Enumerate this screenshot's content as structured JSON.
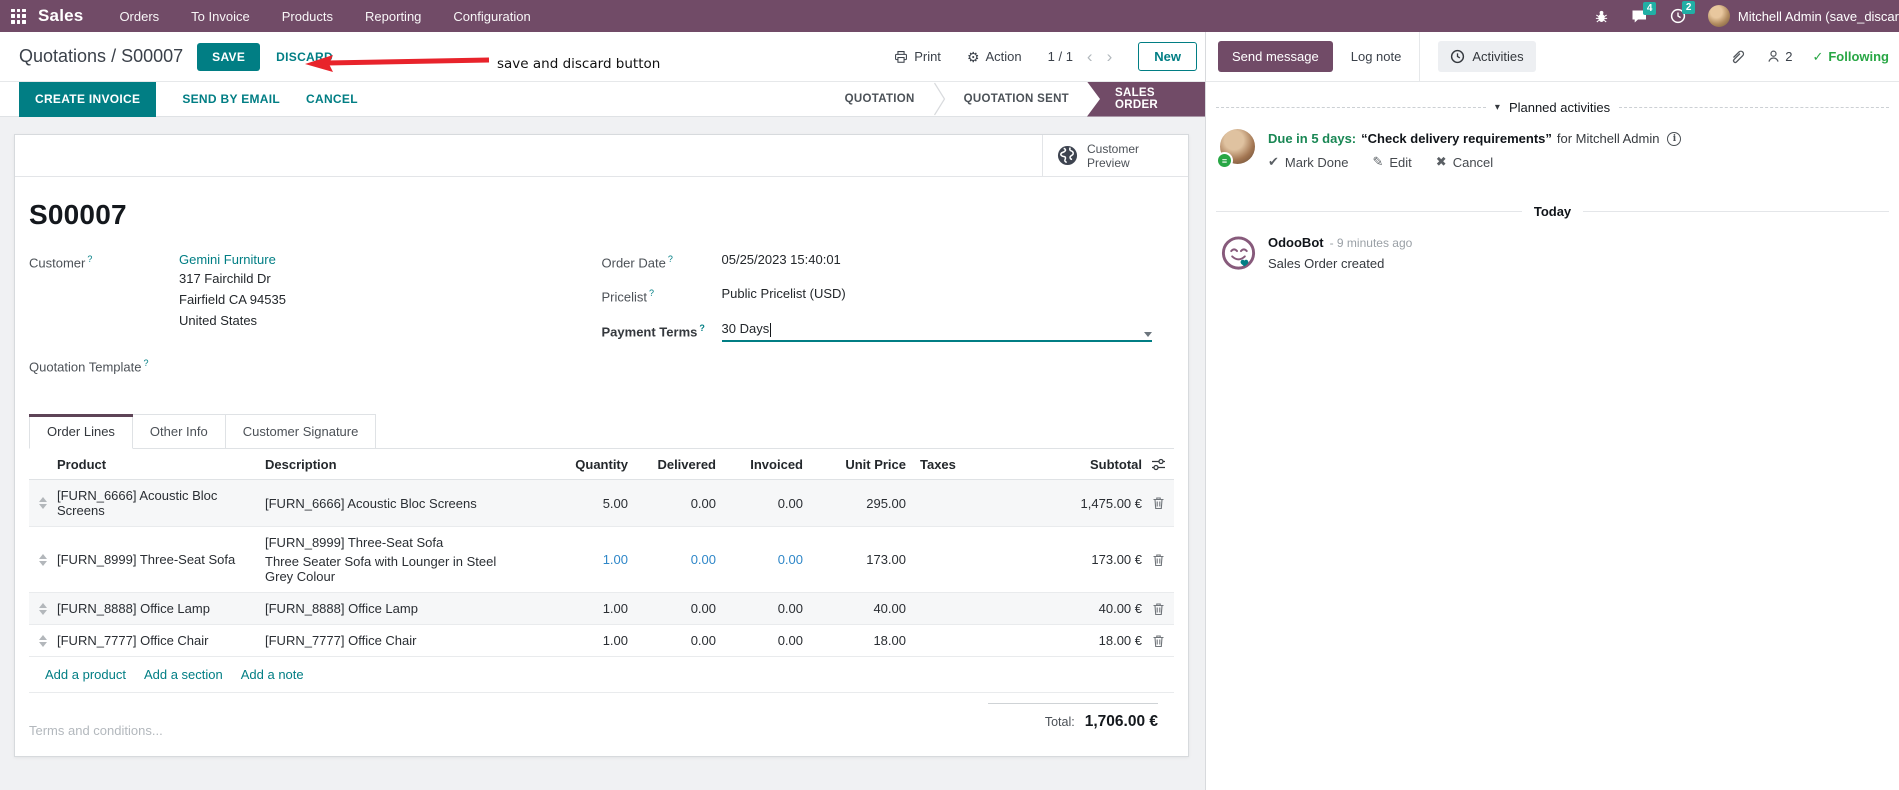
{
  "colors": {
    "brand": "#714B67",
    "primary": "#017E84",
    "success": "#28a745",
    "modified_cell": "#2f87c8",
    "annotation_red": "#e8232b",
    "badge": "#21AFA5"
  },
  "icons": {
    "gear": "⚙",
    "chevron_left": "‹",
    "chevron_right": "›",
    "caret_down": "▾",
    "check": "✔",
    "pencil": "✎",
    "cross": "✖",
    "info": "i",
    "following_check": "✓",
    "list_badge": "≡",
    "breadcrumb_sep": "/"
  },
  "topbar": {
    "app_name": "Sales",
    "menus": [
      {
        "label": "Orders"
      },
      {
        "label": "To Invoice"
      },
      {
        "label": "Products"
      },
      {
        "label": "Reporting"
      },
      {
        "label": "Configuration"
      }
    ],
    "message_count": "4",
    "activity_count": "2",
    "user_name": "Mitchell Admin (save_discar"
  },
  "control": {
    "breadcrumb": "Quotations",
    "record": "S00007",
    "save": "SAVE",
    "discard": "DISCARD",
    "print": "Print",
    "action": "Action",
    "pager": "1 / 1",
    "new": "New"
  },
  "annotation": {
    "label": "save and discard button"
  },
  "statusbar": {
    "create_invoice": "CREATE INVOICE",
    "send_by_email": "SEND BY EMAIL",
    "cancel": "CANCEL",
    "states": [
      {
        "label": "QUOTATION"
      },
      {
        "label": "QUOTATION SENT"
      },
      {
        "label": "SALES ORDER"
      }
    ],
    "active_state": "SALES ORDER"
  },
  "sheet": {
    "preview_line1": "Customer",
    "preview_line2": "Preview",
    "record_name": "S00007",
    "customer": {
      "label": "Customer",
      "help": "?",
      "name": "Gemini Furniture",
      "address": [
        "317 Fairchild Dr",
        "Fairfield CA 94535",
        "United States"
      ]
    },
    "quotation_template": {
      "label": "Quotation Template",
      "help": "?"
    },
    "order_date": {
      "label": "Order Date",
      "help": "?",
      "value": "05/25/2023 15:40:01"
    },
    "pricelist": {
      "label": "Pricelist",
      "help": "?",
      "value": "Public Pricelist (USD)"
    },
    "payment_terms": {
      "label": "Payment Terms",
      "help": "?",
      "value": "30 Days"
    },
    "tabs": [
      {
        "label": "Order Lines"
      },
      {
        "label": "Other Info"
      },
      {
        "label": "Customer Signature"
      }
    ],
    "table": {
      "headers": {
        "product": "Product",
        "description": "Description",
        "quantity": "Quantity",
        "delivered": "Delivered",
        "invoiced": "Invoiced",
        "unit_price": "Unit Price",
        "taxes": "Taxes",
        "subtotal": "Subtotal"
      },
      "rows": [
        {
          "product": "[FURN_6666] Acoustic Bloc Screens",
          "description": "[FURN_6666] Acoustic Bloc Screens",
          "description2": "",
          "quantity": "5.00",
          "delivered": "0.00",
          "invoiced": "0.00",
          "unit_price": "295.00",
          "taxes": "",
          "subtotal": "1,475.00 €"
        },
        {
          "product": "[FURN_8999] Three-Seat Sofa",
          "description": "[FURN_8999] Three-Seat Sofa",
          "description2": "Three Seater Sofa with Lounger in Steel Grey Colour",
          "quantity": "1.00",
          "delivered": "0.00",
          "invoiced": "0.00",
          "unit_price": "173.00",
          "taxes": "",
          "subtotal": "173.00 €"
        },
        {
          "product": "[FURN_8888] Office Lamp",
          "description": "[FURN_8888] Office Lamp",
          "description2": "",
          "quantity": "1.00",
          "delivered": "0.00",
          "invoiced": "0.00",
          "unit_price": "40.00",
          "taxes": "",
          "subtotal": "40.00 €"
        },
        {
          "product": "[FURN_7777] Office Chair",
          "description": "[FURN_7777] Office Chair",
          "description2": "",
          "quantity": "1.00",
          "delivered": "0.00",
          "invoiced": "0.00",
          "unit_price": "18.00",
          "taxes": "",
          "subtotal": "18.00 €"
        }
      ],
      "links": {
        "add_product": "Add a product",
        "add_section": "Add a section",
        "add_note": "Add a note"
      }
    },
    "terms_placeholder": "Terms and conditions...",
    "total": {
      "label": "Total:",
      "value": "1,706.00 €"
    }
  },
  "chatter": {
    "send_message": "Send message",
    "log_note": "Log note",
    "activities": "Activities",
    "followers_count": "2",
    "following": "Following",
    "planned": {
      "title": "Planned activities",
      "due": "Due in 5 days:",
      "summary": "“Check delivery requirements”",
      "assignee": "for Mitchell Admin",
      "mark_done": "Mark Done",
      "edit": "Edit",
      "cancel": "Cancel"
    },
    "today": "Today",
    "message": {
      "author": "OdooBot",
      "timestamp": "- 9 minutes ago",
      "body": "Sales Order created"
    }
  }
}
